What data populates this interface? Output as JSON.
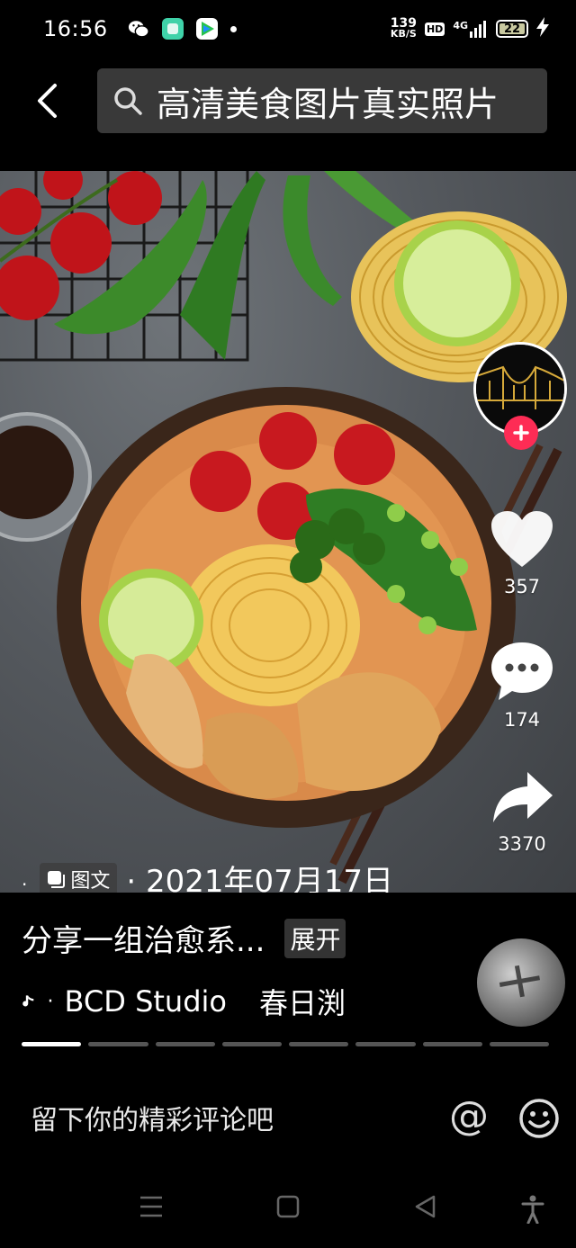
{
  "status_bar": {
    "time": "16:56",
    "net_speed_value": "139",
    "net_speed_unit": "KB/S",
    "hd": "HD",
    "signal": "4G",
    "battery": "22"
  },
  "header": {
    "search_text": "高清美食图片真实照片"
  },
  "actions": {
    "likes": "357",
    "comments": "174",
    "shares": "3370"
  },
  "post": {
    "badge": "图文",
    "date": "· 2021年07月17日",
    "caption": "分享一组治愈系...",
    "expand": "展开",
    "music_author": "BCD Studio",
    "music_title": "春日渕"
  },
  "progress": {
    "segments": 8,
    "active_index": 0
  },
  "comment_bar": {
    "placeholder": "留下你的精彩评论吧",
    "at": "@"
  },
  "colors": {
    "accent": "#fe2c55",
    "background": "#000000",
    "search_bg": "#393939"
  }
}
